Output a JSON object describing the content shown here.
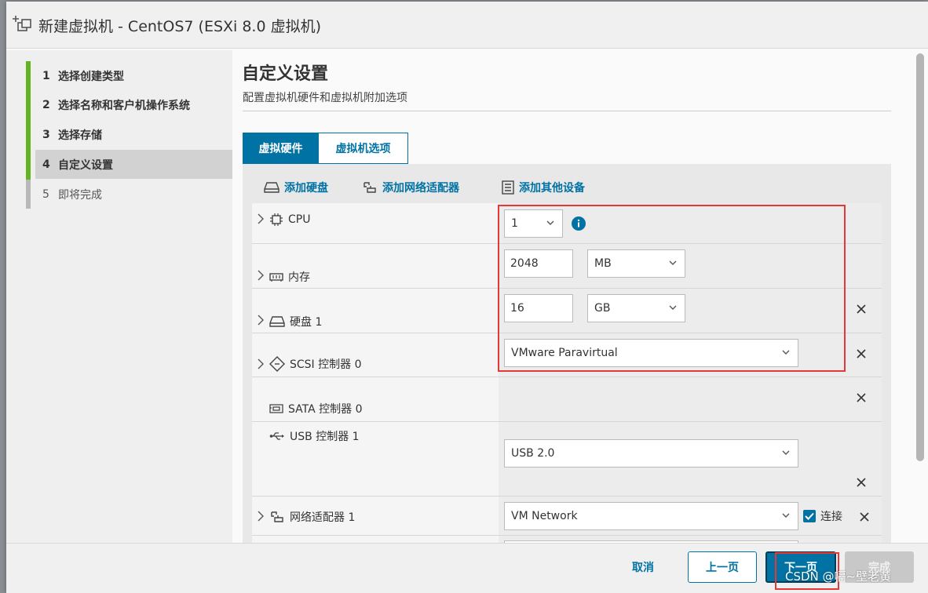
{
  "window": {
    "title": "新建虚拟机 - CentOS7 (ESXi 8.0 虚拟机)",
    "icon": "new-vm-icon"
  },
  "wizard": {
    "steps": [
      {
        "num": "1",
        "label": "选择创建类型",
        "state": "done"
      },
      {
        "num": "2",
        "label": "选择名称和客户机操作系统",
        "state": "done"
      },
      {
        "num": "3",
        "label": "选择存储",
        "state": "done"
      },
      {
        "num": "4",
        "label": "自定义设置",
        "state": "active"
      },
      {
        "num": "5",
        "label": "即将完成",
        "state": "pending"
      }
    ]
  },
  "page": {
    "title": "自定义设置",
    "subtitle": "配置虚拟机硬件和虚拟机附加选项"
  },
  "tabs": [
    {
      "label": "虚拟硬件",
      "active": true
    },
    {
      "label": "虚拟机选项",
      "active": false
    }
  ],
  "actions": {
    "add_disk": "添加硬盘",
    "add_network": "添加网络适配器",
    "add_other": "添加其他设备"
  },
  "hardware": {
    "cpu": {
      "label": "CPU",
      "value": "1"
    },
    "memory": {
      "label": "内存",
      "value": "2048",
      "unit": "MB"
    },
    "disk": {
      "label": "硬盘 1",
      "value": "16",
      "unit": "GB"
    },
    "scsi": {
      "label": "SCSI 控制器 0",
      "value": "VMware Paravirtual"
    },
    "sata": {
      "label": "SATA 控制器 0"
    },
    "usb": {
      "label": "USB 控制器 1",
      "value": "USB 2.0"
    },
    "network": {
      "label": "网络适配器 1",
      "value": "VM Network",
      "connect_label": "连接",
      "connected": true
    }
  },
  "footer": {
    "cancel": "取消",
    "back": "上一页",
    "next": "下一页",
    "finish": "完成"
  },
  "watermark": "CSDN @嗝~壁老黄",
  "colors": {
    "accent": "#0072a3",
    "done": "#62b421",
    "highlight": "#e53935"
  }
}
